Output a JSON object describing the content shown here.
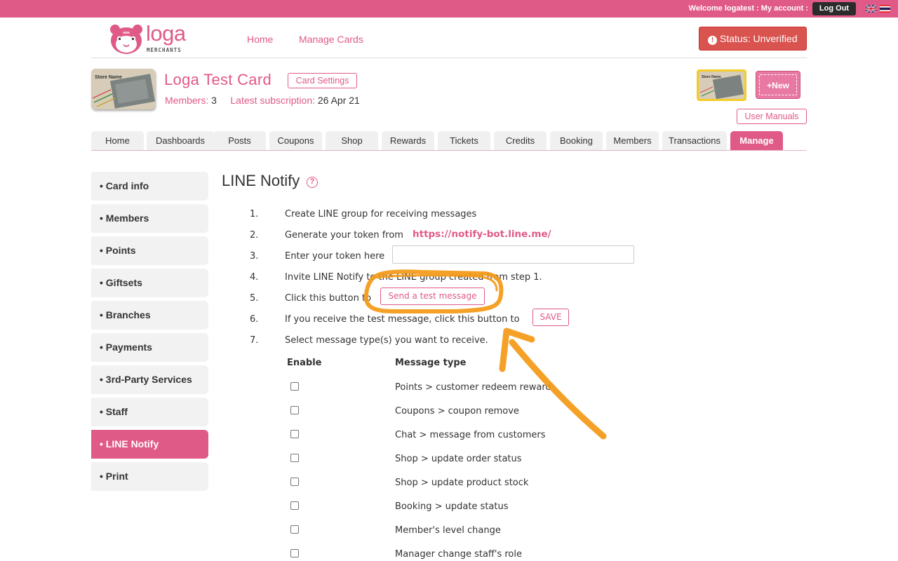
{
  "topbar": {
    "welcome": "Welcome logatest : My account :",
    "logout": "Log Out"
  },
  "brand": {
    "name": "loga",
    "sub": "MERCHANTS"
  },
  "nav": {
    "home": "Home",
    "manage_cards": "Manage Cards"
  },
  "status": {
    "label": "Status: Unverified",
    "color": "#d9534f"
  },
  "card": {
    "thumb_label": "Store Name",
    "title": "Loga Test Card",
    "settings": "Card Settings",
    "members_label": "Members:",
    "members_value": "3",
    "subscription_label": "Latest subscription:",
    "subscription_value": "26 Apr 21"
  },
  "new_card": "+New",
  "user_manuals": "User Manuals",
  "tabs": [
    "Home",
    "Dashboards",
    "Posts",
    "Coupons",
    "Shop",
    "Rewards",
    "Tickets",
    "Credits",
    "Booking",
    "Members",
    "Transactions",
    "Manage"
  ],
  "sidebar": [
    "Card info",
    "Members",
    "Points",
    "Giftsets",
    "Branches",
    "Payments",
    "3rd-Party Services",
    "Staff",
    "LINE Notify",
    "Print"
  ],
  "page": {
    "title": "LINE Notify",
    "help": "?"
  },
  "steps": [
    {
      "n": "1.",
      "text": "Create LINE group for receiving messages"
    },
    {
      "n": "2.",
      "text": "Generate your token from"
    },
    {
      "n": "3.",
      "text": "Enter your token here"
    },
    {
      "n": "4.",
      "text": "Invite LINE Notify to the LINE group created from step 1."
    },
    {
      "n": "5.",
      "text": "Click this button to"
    },
    {
      "n": "6.",
      "text": "If you receive the test message, click this button to"
    },
    {
      "n": "7.",
      "text": "Select message type(s) you want to receive."
    }
  ],
  "token_link": "https://notify-bot.line.me/",
  "token_input": {
    "value": ""
  },
  "test_button": "Send a test message",
  "save_button": "SAVE",
  "table": {
    "col_enable": "Enable",
    "col_type": "Message type",
    "rows": [
      "Points > customer redeem reward",
      "Coupons > coupon remove",
      "Chat > message from customers",
      "Shop > update order status",
      "Shop > update product stock",
      "Booking > update status",
      "Member's level change",
      "Manager change staff's role"
    ]
  },
  "colors": {
    "brand": "#e05a87",
    "annotation": "#f59a16"
  }
}
